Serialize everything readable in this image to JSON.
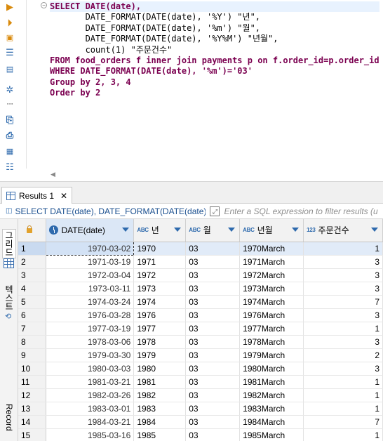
{
  "editor": {
    "query_lines": [
      "SELECT DATE(date),",
      "       DATE_FORMAT(DATE(date), '%Y') \"년\",",
      "       DATE_FORMAT(DATE(date), '%m') \"월\",",
      "       DATE_FORMAT(DATE(date), '%Y%M') \"년월\",",
      "       count(1) \"주문건수\"",
      "FROM food_orders f inner join payments p on f.order_id=p.order_id",
      "WHERE DATE_FORMAT(DATE(date), '%m')='03'",
      "Group by 2, 3, 4",
      "Order by 2"
    ],
    "toolbar_icons": [
      "execute-statement-icon",
      "execute-script-icon",
      "execute-new-tab-icon",
      "explain-plan-icon",
      "output-log-icon",
      "settings-icon",
      "export-icon",
      "load-script-icon",
      "save-script-icon",
      "outline-icon"
    ]
  },
  "results": {
    "tab_label": "Results 1",
    "filter": {
      "query_text": "SELECT DATE(date), DATE_FORMAT(DATE(date), '%",
      "placeholder": "Enter a SQL expression to filter results (u"
    },
    "side_tabs": {
      "grid": "그리드",
      "text": "텍스트",
      "record": "Record"
    },
    "columns": [
      {
        "type": "clock",
        "label": "DATE(date)"
      },
      {
        "type": "ABC",
        "label": "년"
      },
      {
        "type": "ABC",
        "label": "월"
      },
      {
        "type": "ABC",
        "label": "년월"
      },
      {
        "type": "123",
        "label": "주문건수"
      }
    ],
    "rows": [
      [
        "1",
        "1970-03-02",
        "1970",
        "03",
        "1970March",
        "1"
      ],
      [
        "2",
        "1971-03-19",
        "1971",
        "03",
        "1971March",
        "3"
      ],
      [
        "3",
        "1972-03-04",
        "1972",
        "03",
        "1972March",
        "3"
      ],
      [
        "4",
        "1973-03-11",
        "1973",
        "03",
        "1973March",
        "3"
      ],
      [
        "5",
        "1974-03-24",
        "1974",
        "03",
        "1974March",
        "7"
      ],
      [
        "6",
        "1976-03-28",
        "1976",
        "03",
        "1976March",
        "3"
      ],
      [
        "7",
        "1977-03-19",
        "1977",
        "03",
        "1977March",
        "1"
      ],
      [
        "8",
        "1978-03-06",
        "1978",
        "03",
        "1978March",
        "3"
      ],
      [
        "9",
        "1979-03-30",
        "1979",
        "03",
        "1979March",
        "2"
      ],
      [
        "10",
        "1980-03-03",
        "1980",
        "03",
        "1980March",
        "3"
      ],
      [
        "11",
        "1981-03-21",
        "1981",
        "03",
        "1981March",
        "1"
      ],
      [
        "12",
        "1982-03-26",
        "1982",
        "03",
        "1982March",
        "1"
      ],
      [
        "13",
        "1983-03-01",
        "1983",
        "03",
        "1983March",
        "1"
      ],
      [
        "14",
        "1984-03-21",
        "1984",
        "03",
        "1984March",
        "7"
      ],
      [
        "15",
        "1985-03-16",
        "1985",
        "03",
        "1985March",
        "1"
      ]
    ]
  }
}
